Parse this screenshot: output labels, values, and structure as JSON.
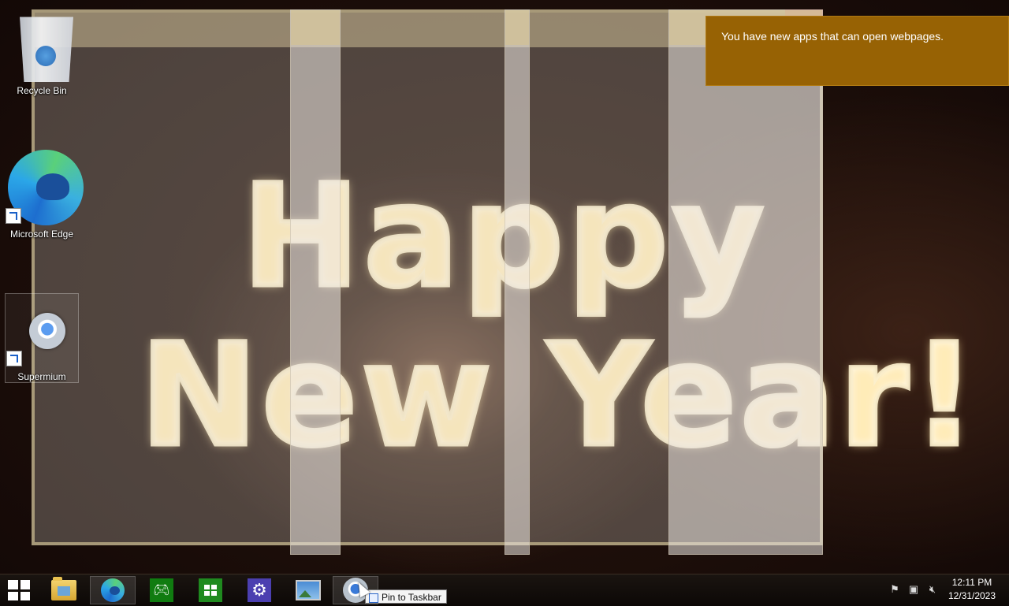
{
  "wallpaper": {
    "line1": "Happy",
    "line2": "New Year!"
  },
  "desktop": {
    "icons": [
      {
        "label": "Recycle Bin",
        "icon": "recycle-bin-icon"
      },
      {
        "label": "Microsoft Edge",
        "icon": "edge-icon"
      },
      {
        "label": "Supermium",
        "icon": "supermium-icon"
      }
    ]
  },
  "toast": {
    "message": "You have new apps that can open webpages.",
    "color": "#976204"
  },
  "taskbar": {
    "apps": [
      {
        "name": "Start",
        "icon": "windows-start-icon"
      },
      {
        "name": "File Explorer",
        "icon": "folder-icon"
      },
      {
        "name": "Microsoft Edge",
        "icon": "edge-icon"
      },
      {
        "name": "Xbox",
        "icon": "xbox-icon"
      },
      {
        "name": "Microsoft Store",
        "icon": "store-icon"
      },
      {
        "name": "Settings",
        "icon": "gear-icon"
      },
      {
        "name": "Photos",
        "icon": "photos-icon"
      },
      {
        "name": "Supermium",
        "icon": "supermium-icon"
      }
    ],
    "tooltip": "Pin to Taskbar",
    "tray": {
      "icons": [
        "flag-icon",
        "network-icon",
        "volume-muted-icon"
      ],
      "time": "12:11 PM",
      "date": "12/31/2023"
    }
  }
}
